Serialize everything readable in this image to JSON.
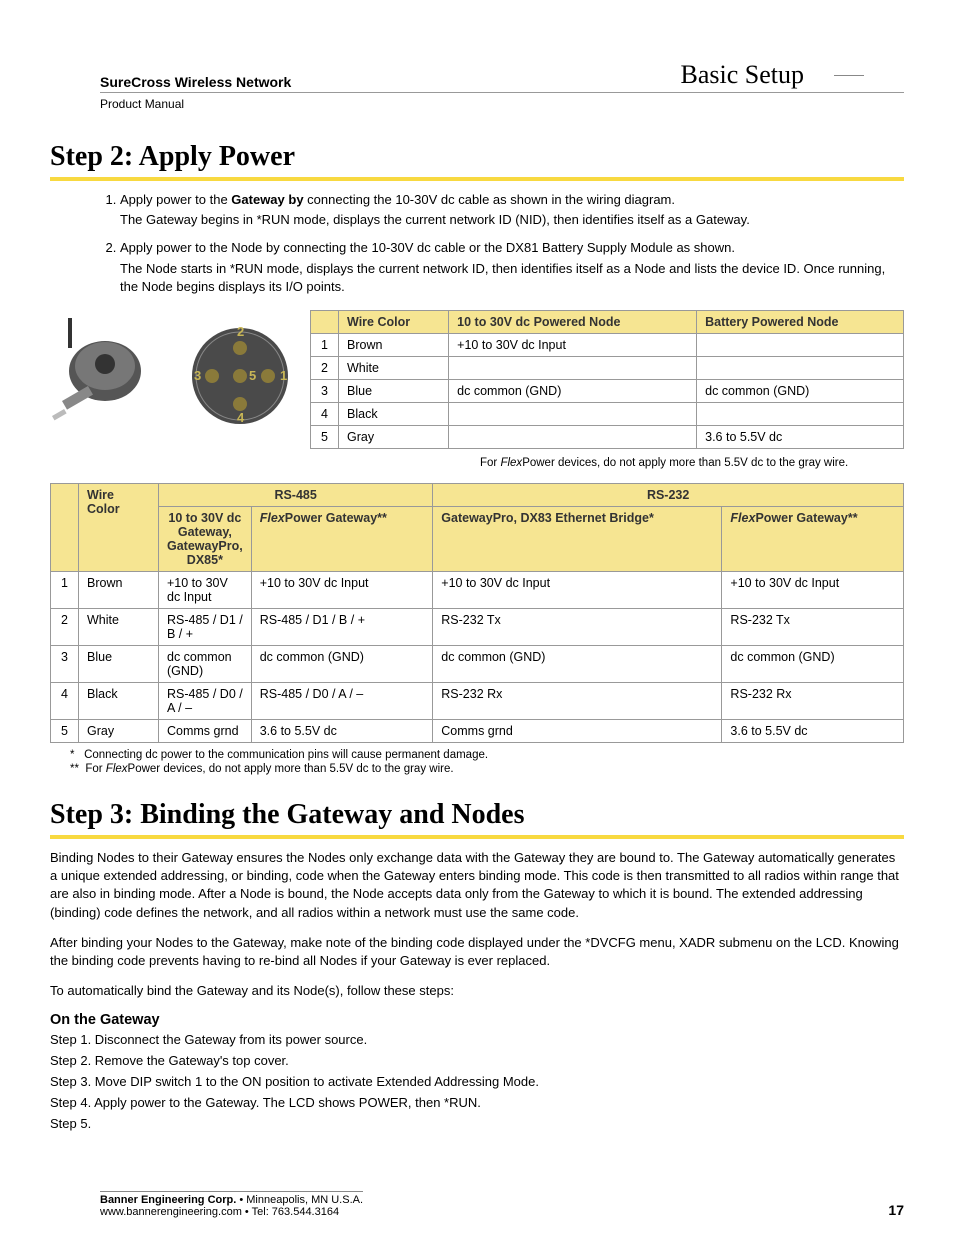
{
  "header": {
    "product_line": "SureCross Wireless Network",
    "subtitle": "Product Manual",
    "section": "Basic Setup"
  },
  "step2": {
    "heading": "Step 2: Apply Power",
    "item1_a": "Apply power to the ",
    "item1_bold": "Gateway by",
    "item1_b": " connecting the 10-30V dc cable as shown in the wiring diagram.",
    "item1_p": "The Gateway begins in *RUN mode, displays the current network ID (NID), then identifies itself as a Gateway.",
    "item2_a": "Apply power to the Node by connecting the 10-30V dc cable or the DX81 Battery Supply Module as shown.",
    "item2_p": "The Node starts in *RUN mode, displays the current network ID, then identifies itself as a Node and lists the device ID. Once running, the Node begins displays its I/O points.",
    "table1_headers": {
      "wire_color": "Wire Color",
      "powered_node": "10 to 30V dc Powered Node",
      "battery_node": "Battery Powered Node"
    },
    "table1_rows": [
      {
        "n": "1",
        "wc": "Brown",
        "pn": "+10 to 30V dc Input",
        "bn": ""
      },
      {
        "n": "2",
        "wc": "White",
        "pn": "",
        "bn": ""
      },
      {
        "n": "3",
        "wc": "Blue",
        "pn": "dc common (GND)",
        "bn": "dc common (GND)"
      },
      {
        "n": "4",
        "wc": "Black",
        "pn": "",
        "bn": ""
      },
      {
        "n": "5",
        "wc": "Gray",
        "pn": "",
        "bn": "3.6 to 5.5V dc"
      }
    ],
    "table1_note_a": "For ",
    "table1_note_i": "Flex",
    "table1_note_b": "Power devices, do not apply more than 5.5V dc to the gray wire.",
    "table2_top_headers": {
      "rs485": "RS-485",
      "rs232": "RS-232"
    },
    "table2_headers": {
      "wire_color": "Wire Color",
      "col1": "10 to 30V dc Gateway, GatewayPro, DX85*",
      "col2_i": "Flex",
      "col2": "Power Gateway**",
      "col3": "GatewayPro, DX83 Ethernet Bridge*",
      "col4_i": "Flex",
      "col4": "Power Gateway**"
    },
    "table2_rows": [
      {
        "n": "1",
        "wc": "Brown",
        "c1": "+10 to 30V dc Input",
        "c2": "+10 to 30V dc Input",
        "c3": "+10 to 30V dc Input",
        "c4": "+10 to 30V dc Input"
      },
      {
        "n": "2",
        "wc": "White",
        "c1": "RS-485 / D1 / B / +",
        "c2": "RS-485 / D1 / B / +",
        "c3": "RS-232 Tx",
        "c4": "RS-232 Tx"
      },
      {
        "n": "3",
        "wc": "Blue",
        "c1": "dc common (GND)",
        "c2": "dc common (GND)",
        "c3": "dc common (GND)",
        "c4": "dc common (GND)"
      },
      {
        "n": "4",
        "wc": "Black",
        "c1": "RS-485 / D0 / A / –",
        "c2": "RS-485 / D0 / A / –",
        "c3": "RS-232 Rx",
        "c4": "RS-232 Rx"
      },
      {
        "n": "5",
        "wc": "Gray",
        "c1": "Comms grnd",
        "c2": "3.6 to 5.5V dc",
        "c3": "Comms grnd",
        "c4": "3.6 to 5.5V dc"
      }
    ],
    "footnote1": "Connecting dc power to the communication pins will cause permanent damage.",
    "footnote2_a": "For ",
    "footnote2_i": "Flex",
    "footnote2_b": "Power devices, do not apply more than 5.5V dc to the gray wire."
  },
  "step3": {
    "heading": "Step 3: Binding the Gateway and Nodes",
    "p1": "Binding Nodes to their Gateway ensures the Nodes only exchange data with the Gateway they are bound to. The Gateway automatically generates a unique extended addressing, or binding, code when the Gateway enters binding mode. This code is then transmitted to all radios within range that are also in binding mode. After a Node is bound, the Node accepts data only from the Gateway to which it is bound. The extended addressing (binding) code defines the network, and all radios within a network must use the same code.",
    "p2": "After binding your Nodes to the Gateway, make note of the binding code displayed under the *DVCFG menu, XADR submenu on the LCD. Knowing the binding code prevents having to re-bind all Nodes if your Gateway is ever replaced.",
    "p3": "To automatically bind the Gateway and its Node(s), follow these steps:",
    "sub_heading": "On the Gateway",
    "gsteps": [
      "Step 1. Disconnect the Gateway from its power source.",
      "Step 2. Remove the Gateway's top cover.",
      "Step 3. Move DIP switch 1 to the ON position to activate Extended Addressing Mode.",
      "Step 4. Apply power to the Gateway. The LCD shows POWER, then *RUN.",
      "Step 5."
    ]
  },
  "footer": {
    "company": "Banner Engineering Corp.",
    "loc": " •  Minneapolis, MN U.S.A.",
    "contact": "www.bannerengineering.com  •  Tel: 763.544.3164",
    "page": "17"
  },
  "connector_labels": {
    "1": "1",
    "2": "2",
    "3": "3",
    "4": "4",
    "5": "5"
  }
}
